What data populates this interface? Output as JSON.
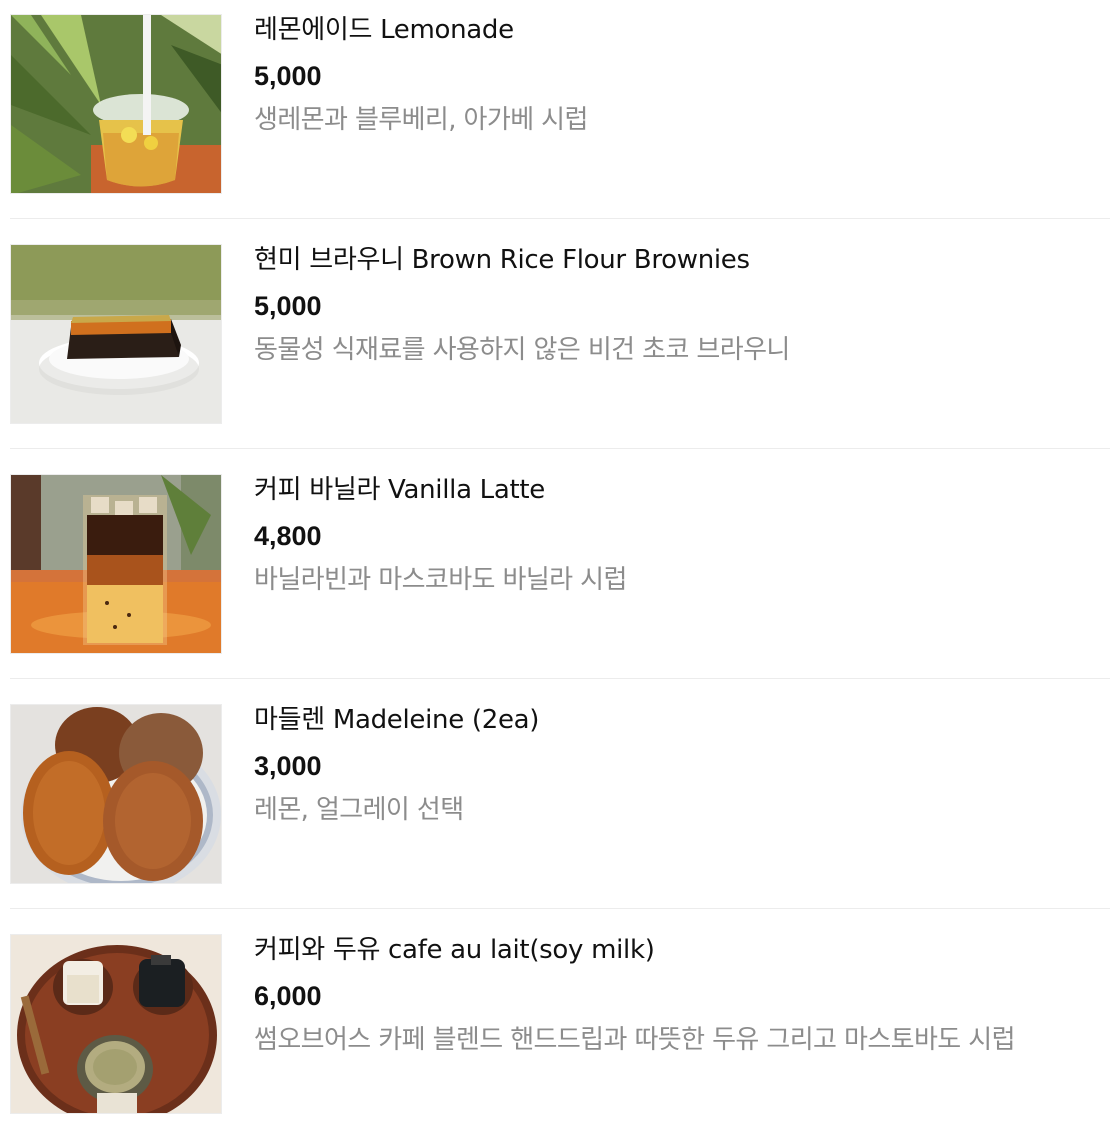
{
  "menu": {
    "items": [
      {
        "name": "레몬에이드 Lemonade",
        "price": "5,000",
        "description": "생레몬과 블루베리, 아가베 시럽",
        "image": "lemonade-photo"
      },
      {
        "name": "현미 브라우니 Brown Rice Flour Brownies",
        "price": "5,000",
        "description": "동물성 식재료를 사용하지 않은 비건 초코 브라우니",
        "image": "brownie-photo"
      },
      {
        "name": "커피 바닐라 Vanilla Latte",
        "price": "4,800",
        "description": "바닐라빈과 마스코바도 바닐라 시럽",
        "image": "vanilla-latte-photo"
      },
      {
        "name": "마들렌 Madeleine (2ea)",
        "price": "3,000",
        "description": "레몬, 얼그레이 선택",
        "image": "madeleine-photo"
      },
      {
        "name": "커피와 두유 cafe au lait(soy milk)",
        "price": "6,000",
        "description": "썸오브어스 카페 블렌드 핸드드립과 따뜻한 두유 그리고 마스토바도 시럽",
        "image": "cafe-au-lait-photo"
      }
    ]
  }
}
